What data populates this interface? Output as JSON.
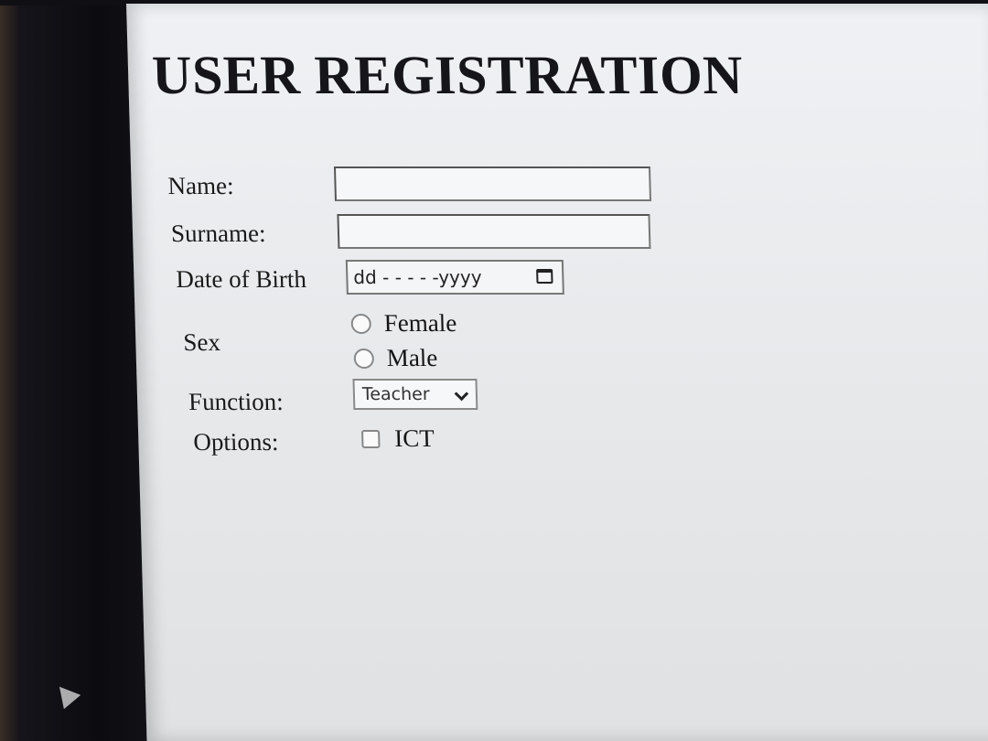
{
  "form": {
    "title": "USER REGISTRATION",
    "name_label": "Name:",
    "name_value": "",
    "surname_label": "Surname:",
    "surname_value": "",
    "dob_label": "Date of Birth",
    "dob_placeholder": "dd - - - - -yyyy",
    "sex_label": "Sex",
    "sex_options": [
      "Female",
      "Male"
    ],
    "function_label": "Function:",
    "function_selected": "Teacher",
    "options_label": "Options:",
    "options_items": [
      "ICT"
    ]
  },
  "icons": {
    "calendar": "calendar-icon",
    "dropdown": "chevron-down-icon"
  }
}
